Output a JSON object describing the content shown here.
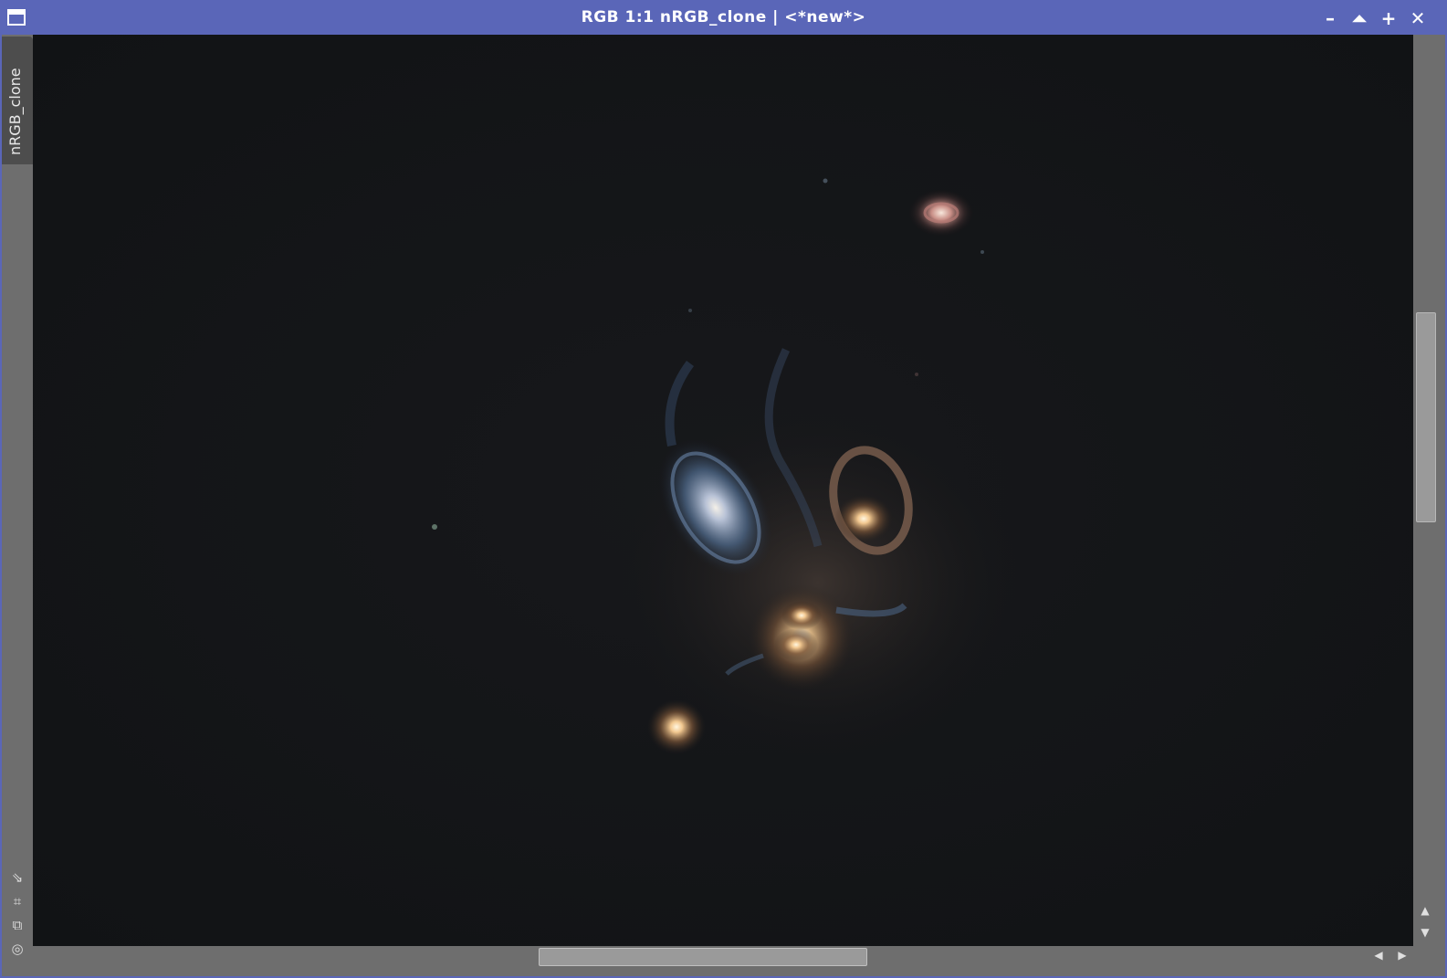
{
  "window": {
    "title": "RGB 1:1 nRGB_clone | <*new*>",
    "icon": "window-icon",
    "controls": {
      "minimize": "–",
      "shade": "⏶",
      "maximize": "+",
      "close": "✕"
    }
  },
  "sidebar": {
    "tab_label": "nRGB_clone",
    "tools": [
      "fit-view-icon",
      "zoom-box-icon",
      "clone-view-icon",
      "target-icon"
    ],
    "tool_glyphs": [
      "⇘",
      "⌗",
      "⧉",
      "◎"
    ]
  },
  "scrollbars": {
    "up": "▲",
    "down": "▼",
    "left": "◀",
    "right": "▶"
  },
  "colors": {
    "titlebar": "#5a66b8",
    "frame": "#6e6e6e",
    "background_sky": "#121416"
  }
}
